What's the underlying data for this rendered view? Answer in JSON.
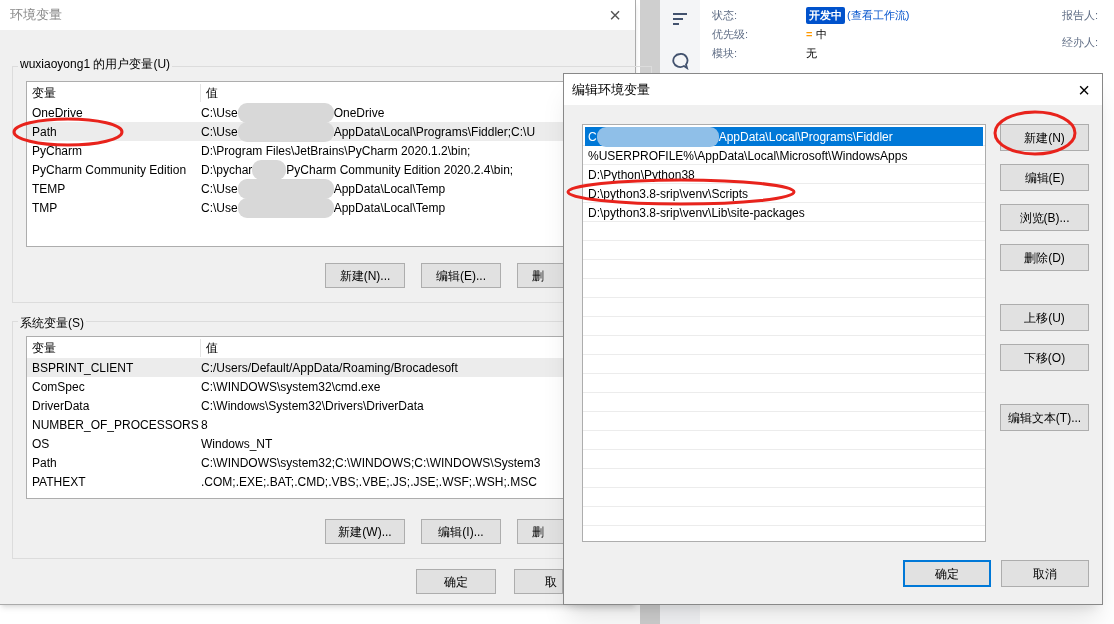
{
  "background_app": {
    "fields": [
      {
        "label": "状态:",
        "kind": "status",
        "badge": "开发中",
        "link": "(查看工作流)"
      },
      {
        "label": "优先级:",
        "kind": "priority",
        "icon_text": "=",
        "value": "中"
      },
      {
        "label": "模块:",
        "kind": "text",
        "value": "无"
      }
    ],
    "side_labels": [
      "报告人:",
      "经办人:"
    ]
  },
  "env_dialog": {
    "title": "环境变量",
    "close": "×",
    "user_group": {
      "title": "wuxiaoyong1 的用户变量(U)",
      "columns": [
        "变量",
        "值"
      ],
      "rows": [
        {
          "name": "OneDrive",
          "value_start": "C:\\Use",
          "value_end": "OneDrive",
          "redacted": true,
          "selected": false,
          "circled": false
        },
        {
          "name": "Path",
          "value_start": "C:\\Use",
          "value_end": "AppData\\Local\\Programs\\Fiddler;C:\\U",
          "redacted": true,
          "selected": true,
          "circled": true
        },
        {
          "name": "PyCharm",
          "value_start": "D:\\Program Files\\JetBrains\\PyCharm 2020.1.2\\bin;",
          "redacted": false,
          "selected": false,
          "circled": false
        },
        {
          "name": "PyCharm Community Edition",
          "value_start": "D:\\pychar",
          "value_end": "PyCharm Community Edition 2020.2.4\\bin;",
          "redacted": true,
          "selected": false,
          "circled": false
        },
        {
          "name": "TEMP",
          "value_start": "C:\\Use",
          "value_end": "AppData\\Local\\Temp",
          "redacted": true,
          "selected": false,
          "circled": false
        },
        {
          "name": "TMP",
          "value_start": "C:\\Use",
          "value_end": "AppData\\Local\\Temp",
          "redacted": true,
          "selected": false,
          "circled": false
        }
      ],
      "buttons": [
        "新建(N)...",
        "编辑(E)...",
        "删"
      ]
    },
    "system_group": {
      "title": "系统变量(S)",
      "columns": [
        "变量",
        "值"
      ],
      "rows": [
        {
          "name": "BSPRINT_CLIENT",
          "value_start": "C:/Users/Default/AppData/Roaming/Brocadesoft",
          "redacted": false,
          "selected": true,
          "circled": false
        },
        {
          "name": "ComSpec",
          "value_start": "C:\\WINDOWS\\system32\\cmd.exe",
          "redacted": false,
          "selected": false,
          "circled": false
        },
        {
          "name": "DriverData",
          "value_start": "C:\\Windows\\System32\\Drivers\\DriverData",
          "redacted": false,
          "selected": false,
          "circled": false
        },
        {
          "name": "NUMBER_OF_PROCESSORS",
          "value_start": "8",
          "redacted": false,
          "selected": false,
          "circled": false
        },
        {
          "name": "OS",
          "value_start": "Windows_NT",
          "redacted": false,
          "selected": false,
          "circled": false
        },
        {
          "name": "Path",
          "value_start": "C:\\WINDOWS\\system32;C:\\WINDOWS;C:\\WINDOWS\\System3",
          "redacted": false,
          "selected": false,
          "circled": false
        },
        {
          "name": "PATHEXT",
          "value_start": ".COM;.EXE;.BAT;.CMD;.VBS;.VBE;.JS;.JSE;.WSF;.WSH;.MSC",
          "redacted": false,
          "selected": false,
          "circled": false
        }
      ],
      "buttons": [
        "新建(W)...",
        "编辑(I)...",
        "删"
      ]
    },
    "footer_buttons": [
      "确定",
      "取"
    ]
  },
  "edit_dialog": {
    "title": "编辑环境变量",
    "close": "×",
    "entries": [
      {
        "value_start": "C",
        "value_end": "AppData\\Local\\Programs\\Fiddler",
        "redacted": true,
        "selected": true,
        "circled": false
      },
      {
        "value_start": "%USERPROFILE%\\AppData\\Local\\Microsoft\\WindowsApps",
        "redacted": false,
        "selected": false,
        "circled": false
      },
      {
        "value_start": "D:\\Python\\Python38",
        "redacted": false,
        "selected": false,
        "circled": false
      },
      {
        "value_start": "D:\\python3.8-srip\\venv\\Scripts",
        "redacted": false,
        "selected": false,
        "circled": true
      },
      {
        "value_start": "D:\\python3.8-srip\\venv\\Lib\\site-packages",
        "redacted": false,
        "selected": false,
        "circled": false
      }
    ],
    "side_button_groups": [
      [
        {
          "label": "新建(N)",
          "circled": true
        },
        {
          "label": "编辑(E)",
          "circled": false
        },
        {
          "label": "浏览(B)...",
          "circled": false
        },
        {
          "label": "删除(D)",
          "circled": false
        }
      ],
      [
        {
          "label": "上移(U)",
          "circled": false
        },
        {
          "label": "下移(O)",
          "circled": false
        }
      ],
      [
        {
          "label": "编辑文本(T)...",
          "circled": false
        }
      ]
    ],
    "footer_buttons": [
      {
        "label": "确定",
        "default": true
      },
      {
        "label": "取消",
        "default": false
      }
    ]
  }
}
